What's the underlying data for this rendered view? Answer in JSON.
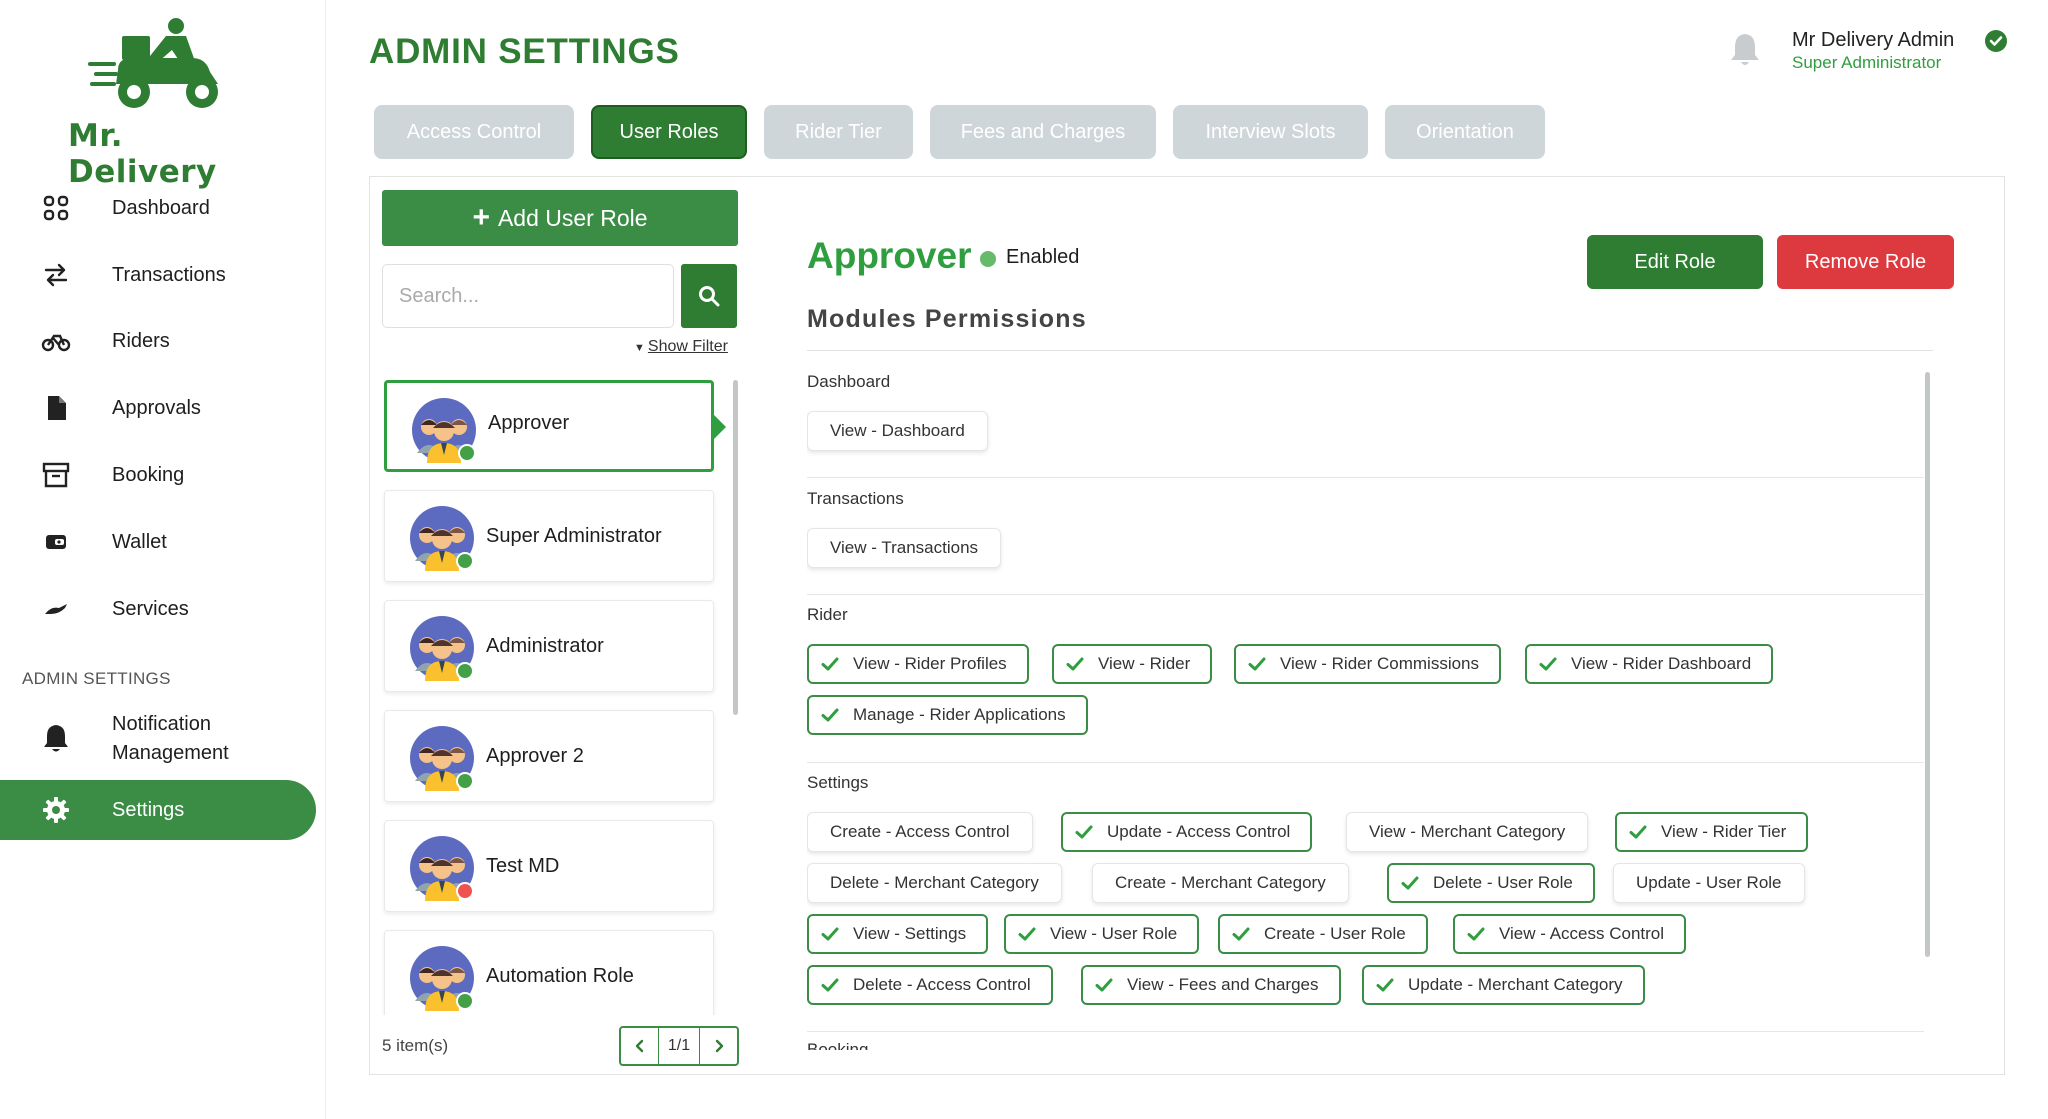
{
  "app": {
    "brand": "Mr. Delivery",
    "colors": {
      "primary": "#2e7d32",
      "accent": "#3b8c45",
      "danger": "#dc3a3f",
      "tab_inactive": "#cfd6d9"
    }
  },
  "sidebar": {
    "items": [
      {
        "label": "Dashboard",
        "icon": "grid-icon"
      },
      {
        "label": "Transactions",
        "icon": "swap-arrows-icon"
      },
      {
        "label": "Riders",
        "icon": "motorbike-icon"
      },
      {
        "label": "Approvals",
        "icon": "document-icon"
      },
      {
        "label": "Booking",
        "icon": "archive-box-icon"
      },
      {
        "label": "Wallet",
        "icon": "wallet-icon"
      },
      {
        "label": "Services",
        "icon": "hand-icon"
      }
    ],
    "section_label": "ADMIN SETTINGS",
    "admin_items": [
      {
        "label_line1": "Notification",
        "label_line2": "Management",
        "icon": "bell-icon"
      },
      {
        "label": "Settings",
        "icon": "gear-icon",
        "active": true
      }
    ]
  },
  "header": {
    "title": "ADMIN SETTINGS",
    "user_name": "Mr Delivery Admin",
    "user_role": "Super Administrator"
  },
  "tabs": [
    {
      "label": "Access Control",
      "active": false
    },
    {
      "label": "User Roles",
      "active": true
    },
    {
      "label": "Rider Tier",
      "active": false
    },
    {
      "label": "Fees and Charges",
      "active": false
    },
    {
      "label": "Interview Slots",
      "active": false
    },
    {
      "label": "Orientation",
      "active": false
    }
  ],
  "roles_panel": {
    "add_button": "Add User Role",
    "search_placeholder": "Search...",
    "show_filter": "Show Filter",
    "roles": [
      {
        "name": "Approver",
        "status": "enabled",
        "selected": true
      },
      {
        "name": "Super Administrator",
        "status": "enabled"
      },
      {
        "name": "Administrator",
        "status": "enabled"
      },
      {
        "name": "Approver 2",
        "status": "enabled"
      },
      {
        "name": "Test MD",
        "status": "disabled"
      },
      {
        "name": "Automation Role",
        "status": "enabled"
      }
    ],
    "items_count": "5 item(s)",
    "page": "1/1"
  },
  "detail": {
    "role_name": "Approver",
    "status": "Enabled",
    "edit_button": "Edit Role",
    "remove_button": "Remove Role",
    "modules_title": "Modules Permissions",
    "modules": [
      {
        "name": "Dashboard",
        "permissions": [
          {
            "label": "View - Dashboard",
            "checked": false
          }
        ]
      },
      {
        "name": "Transactions",
        "permissions": [
          {
            "label": "View - Transactions",
            "checked": false
          }
        ]
      },
      {
        "name": "Rider",
        "permissions": [
          {
            "label": "View - Rider Profiles",
            "checked": true
          },
          {
            "label": "View - Rider",
            "checked": true
          },
          {
            "label": "View - Rider Commissions",
            "checked": true
          },
          {
            "label": "View - Rider Dashboard",
            "checked": true
          },
          {
            "label": "Manage - Rider Applications",
            "checked": true
          }
        ]
      },
      {
        "name": "Settings",
        "permissions": [
          {
            "label": "Create - Access Control",
            "checked": false
          },
          {
            "label": "Update - Access Control",
            "checked": true
          },
          {
            "label": "View - Merchant Category",
            "checked": false
          },
          {
            "label": "View - Rider Tier",
            "checked": true
          },
          {
            "label": "Delete - Merchant Category",
            "checked": false
          },
          {
            "label": "Create - Merchant Category",
            "checked": false
          },
          {
            "label": "Delete - User Role",
            "checked": true
          },
          {
            "label": "Update - User Role",
            "checked": false
          },
          {
            "label": "View - Settings",
            "checked": true
          },
          {
            "label": "View - User Role",
            "checked": true
          },
          {
            "label": "Create - User Role",
            "checked": true
          },
          {
            "label": "View - Access Control",
            "checked": true
          },
          {
            "label": "Delete - Access Control",
            "checked": true
          },
          {
            "label": "View - Fees and Charges",
            "checked": true
          },
          {
            "label": "Update - Merchant Category",
            "checked": true
          }
        ]
      }
    ],
    "next_module_partial": "Booking"
  }
}
